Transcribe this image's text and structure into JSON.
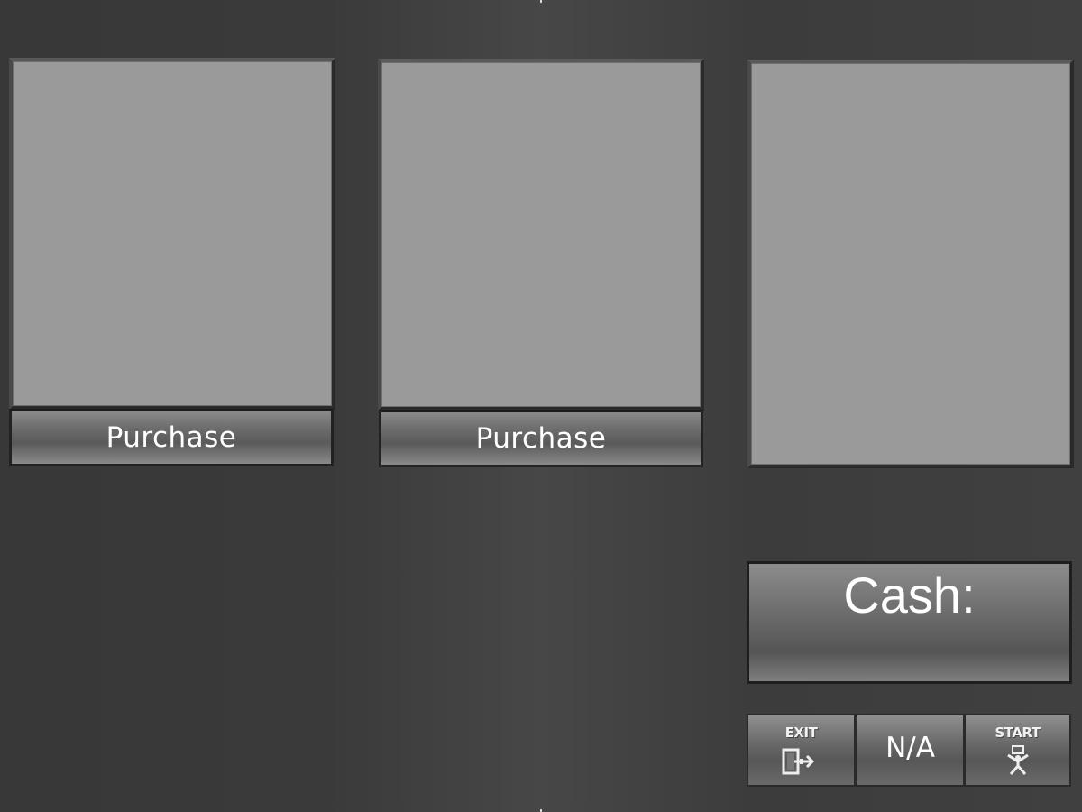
{
  "products": [
    {
      "purchase_label": "Purchase"
    },
    {
      "purchase_label": "Purchase"
    },
    {}
  ],
  "wallet": {
    "cash_label": "Cash:",
    "cash_value": ""
  },
  "controls": {
    "exit_label": "EXIT",
    "exit_icon": "exit-door-icon",
    "middle_label": "N/A",
    "start_label": "START",
    "start_icon": "start-figure-icon"
  },
  "colors": {
    "background": "#3e3e3e",
    "panel": "#9a9a9a",
    "text": "#ffffff"
  }
}
